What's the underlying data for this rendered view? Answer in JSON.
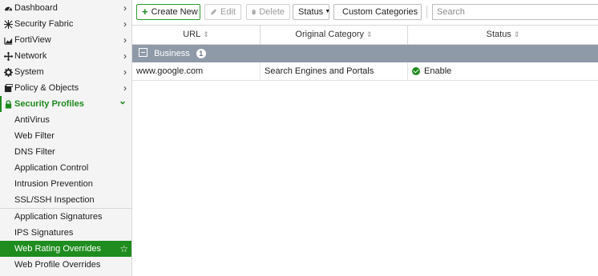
{
  "sidebar": {
    "items": [
      {
        "label": "Dashboard",
        "icon": "dashboard-icon"
      },
      {
        "label": "Security Fabric",
        "icon": "fabric-icon"
      },
      {
        "label": "FortiView",
        "icon": "chart-icon"
      },
      {
        "label": "Network",
        "icon": "network-icon"
      },
      {
        "label": "System",
        "icon": "gear-icon"
      },
      {
        "label": "Policy & Objects",
        "icon": "policy-icon"
      },
      {
        "label": "Security Profiles",
        "icon": "lock-icon"
      }
    ],
    "sub_items": [
      "AntiVirus",
      "Web Filter",
      "DNS Filter",
      "Application Control",
      "Intrusion Prevention",
      "SSL/SSH Inspection",
      "Application Signatures",
      "IPS Signatures",
      "Web Rating Overrides",
      "Web Profile Overrides"
    ],
    "chevron_right": "›",
    "chevron_down": "⌄",
    "star": "☆"
  },
  "toolbar": {
    "create_label": "Create New",
    "edit_label": "Edit",
    "delete_label": "Delete",
    "status_label": "Status",
    "custom_label": "Custom Categories",
    "search_placeholder": "Search"
  },
  "table": {
    "headers": {
      "url": "URL",
      "category": "Original Category",
      "status": "Status"
    },
    "group": {
      "label": "Business",
      "count": "1"
    },
    "rows": [
      {
        "url": "www.google.com",
        "category": "Search Engines and Portals",
        "status": "Enable"
      }
    ]
  },
  "colors": {
    "accent": "#1d8a1d",
    "group_bg": "#8f9aa8",
    "selected_bg": "#1e8c1e"
  }
}
